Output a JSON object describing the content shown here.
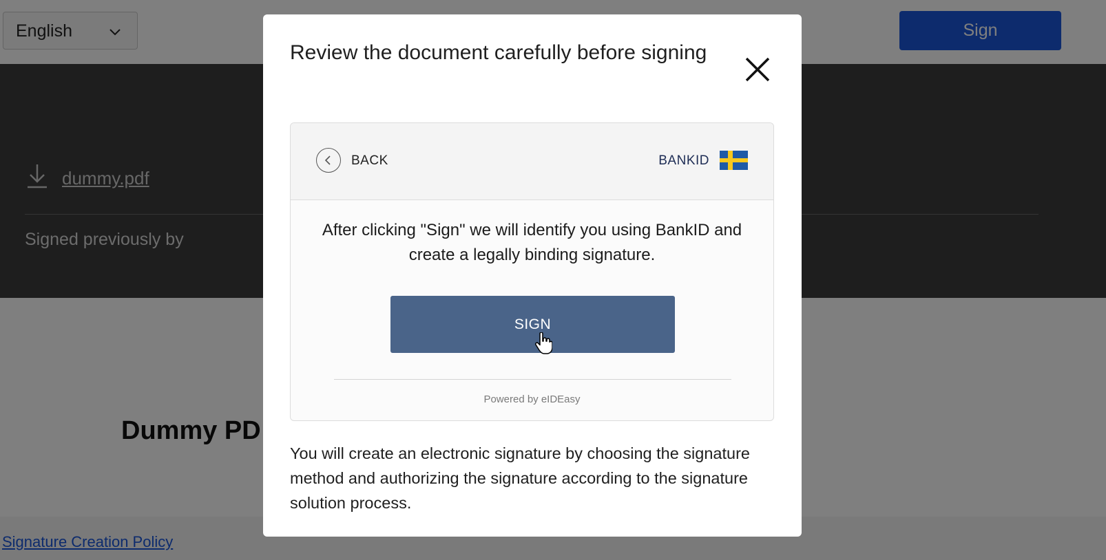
{
  "page": {
    "language_select": {
      "value": "English",
      "icon": "chevron-down-icon"
    },
    "top_sign_button": {
      "label": "Sign",
      "color": "#1a56db"
    },
    "file": {
      "name": "dummy.pdf",
      "icon": "download-icon"
    },
    "signed_previously_label": "Signed previously by",
    "document_preview_title": "Dummy PD",
    "footer": {
      "policy_link": "Signature Creation Policy"
    }
  },
  "modal": {
    "title": "Review the document carefully before signing",
    "close_icon": "close-icon",
    "card": {
      "back_label": "BACK",
      "provider_label": "BANKID",
      "provider_flag": "sweden-flag-icon",
      "instruction": "After clicking \"Sign\" we will identify you using BankID and create a legally binding signature.",
      "sign_button_label": "SIGN",
      "sign_button_color": "#4a6489",
      "powered_by": "Powered by eIDEasy"
    },
    "footer_text": "You will create an electronic signature by choosing the signature method and authorizing the signature according to the signature solution process."
  }
}
